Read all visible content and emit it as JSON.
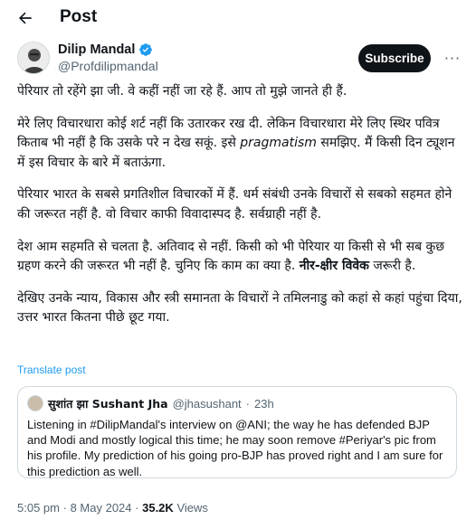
{
  "header": {
    "title": "Post"
  },
  "author": {
    "name": "Dilip Mandal",
    "handle": "@Profdilipmandal"
  },
  "actions": {
    "subscribe_label": "Subscribe",
    "more_label": "···"
  },
  "post": {
    "p1": "पेरियार तो रहेंगे झा जी. वे कहीं नहीं जा रहे हैं. आप तो मुझे जानते ही हैं.",
    "p2_a": "मेरे लिए विचारधारा कोई शर्ट नहीं कि उतारकर रख दी. लेकिन विचारधारा मेरे लिए स्थिर पवित्र किताब भी नहीं है कि उसके परे न देख सकूं. इसे ",
    "p2_em": "pragmatism",
    "p2_b": " समझिए. मैं किसी दिन ट्यूशन में इस विचार के बारे में बताऊंगा.",
    "p3": "पेरियार भारत के सबसे प्रगतिशील विचारकों में हैं. धर्म संबंधी उनके विचारों से सबको सहमत होने की जरूरत नहीं है. वो विचार काफी विवादास्पद है. सर्वग्राही नहीं है.",
    "p4_a": "देश आम सहमति से चलता है. अतिवाद से नहीं. किसी को भी पेरियार या किसी से भी सब कुछ ग्रहण करने की जरूरत भी नहीं है. चुनिए कि काम का क्या है. ",
    "p4_bold": "नीर-क्षीर विवेक",
    "p4_b": " जरूरी है.",
    "p5": "देखिए उनके न्याय, विकास और स्त्री समानता के विचारों ने तमिलनाडु को कहां से कहां पहुंचा दिया, उत्तर भारत कितना पीछे छूट गया.",
    "translate": "Translate post"
  },
  "quote": {
    "name": "सुशांत झा Sushant Jha",
    "handle": "@jhasushant",
    "sep": "·",
    "time": "23h",
    "text": "Listening in #DilipMandal's interview on @ANI; the way he has defended BJP and Modi and mostly logical this time; he may soon remove #Periyar's pic from his profile. My prediction of his going pro-BJP has proved right and I am sure for this prediction as well."
  },
  "meta": {
    "time": "5:05 pm",
    "sep1": "·",
    "date": "8 May 2024",
    "sep2": "·",
    "views": "35.2K",
    "views_label": "Views"
  },
  "colors": {
    "link": "#1d9bf0",
    "text": "#0f1419",
    "muted": "#536471",
    "border": "#cfd9de",
    "verified": "#1d9bf0"
  }
}
